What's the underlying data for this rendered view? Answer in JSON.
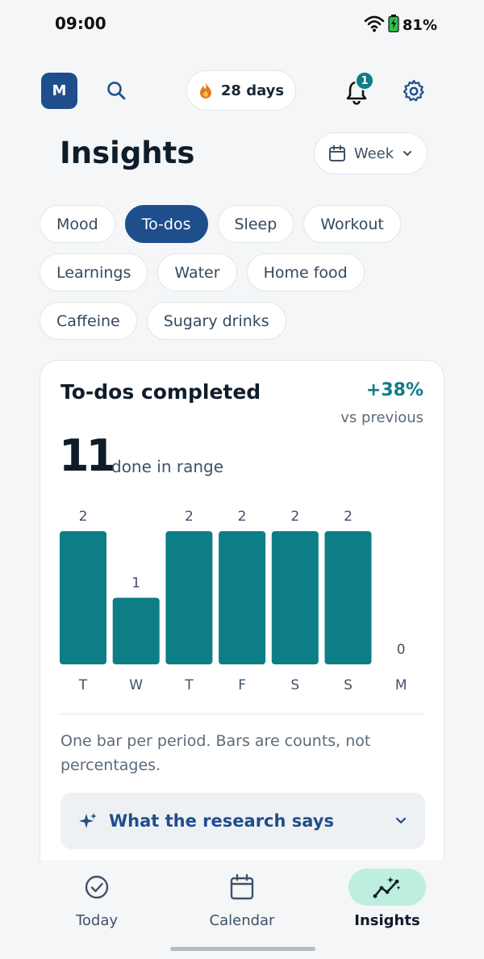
{
  "status_bar": {
    "time": "09:00",
    "battery": "81%"
  },
  "header": {
    "avatar_initial": "M",
    "streak_label": "28 days",
    "notification_count": "1"
  },
  "page": {
    "title": "Insights",
    "range_label": "Week"
  },
  "chips": {
    "rows": [
      [
        {
          "label": "Mood",
          "active": false
        },
        {
          "label": "To-dos",
          "active": true
        },
        {
          "label": "Sleep",
          "active": false
        },
        {
          "label": "Workout",
          "active": false
        }
      ],
      [
        {
          "label": "Learnings",
          "active": false
        },
        {
          "label": "Water",
          "active": false
        },
        {
          "label": "Home food",
          "active": false
        }
      ],
      [
        {
          "label": "Caffeine",
          "active": false
        },
        {
          "label": "Sugary drinks",
          "active": false
        }
      ]
    ]
  },
  "card": {
    "title": "To-dos completed",
    "delta": "+38%",
    "vs_label": "vs previous",
    "count": "11",
    "count_unit": "done in range",
    "note": "One bar per period. Bars are counts, not percentages.",
    "research_label": "What the research says"
  },
  "chart_data": {
    "type": "bar",
    "categories": [
      "T",
      "W",
      "T",
      "F",
      "S",
      "S",
      "M"
    ],
    "values": [
      2,
      1,
      2,
      2,
      2,
      2,
      0
    ],
    "ylim": [
      0,
      2
    ],
    "grid": false,
    "title": "",
    "xlabel": "",
    "ylabel": "",
    "color": "#0d7d86"
  },
  "bottom_nav": {
    "items": [
      {
        "label": "Today",
        "icon": "check-circle-icon",
        "active": false
      },
      {
        "label": "Calendar",
        "icon": "calendar-icon",
        "active": false
      },
      {
        "label": "Insights",
        "icon": "trend-sparkle-icon",
        "active": true
      }
    ]
  },
  "colors": {
    "accent": "#0d7d86",
    "primary": "#1f4e8c",
    "background": "#f4f6f8"
  }
}
